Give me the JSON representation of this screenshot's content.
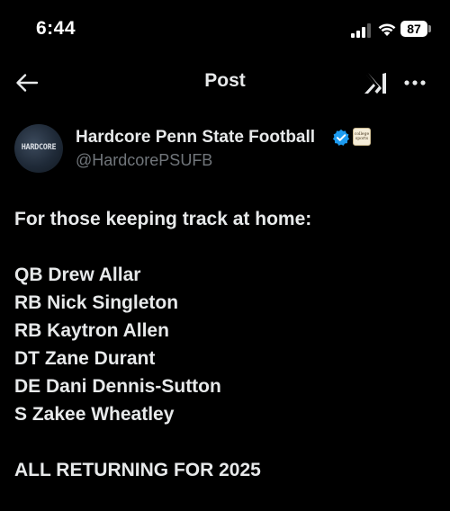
{
  "status_bar": {
    "time": "6:44",
    "battery_level": "87",
    "signal_bars": 3
  },
  "header": {
    "title": "Post",
    "back_icon": "arrow-left-icon",
    "grok_icon": "grok-icon",
    "more_icon": "more-horizontal-icon"
  },
  "author": {
    "display_name": "Hardcore Penn State Football",
    "handle": "@HardcorePSUFB",
    "avatar_text": "HARDCORE",
    "verified": true,
    "verified_color": "#1d9bf0",
    "affiliate_badge_text": "college sports"
  },
  "post": {
    "intro": "For those keeping track at home:",
    "players": [
      "QB Drew Allar",
      "RB Nick Singleton",
      "RB Kaytron Allen",
      "DT Zane Durant",
      "DE Dani Dennis-Sutton",
      "S Zakee Wheatley"
    ],
    "closing": "ALL RETURNING FOR 2025"
  },
  "colors": {
    "background": "#000000",
    "primary_text": "#e7e9ea",
    "secondary_text": "#71767b",
    "accent": "#1d9bf0"
  }
}
